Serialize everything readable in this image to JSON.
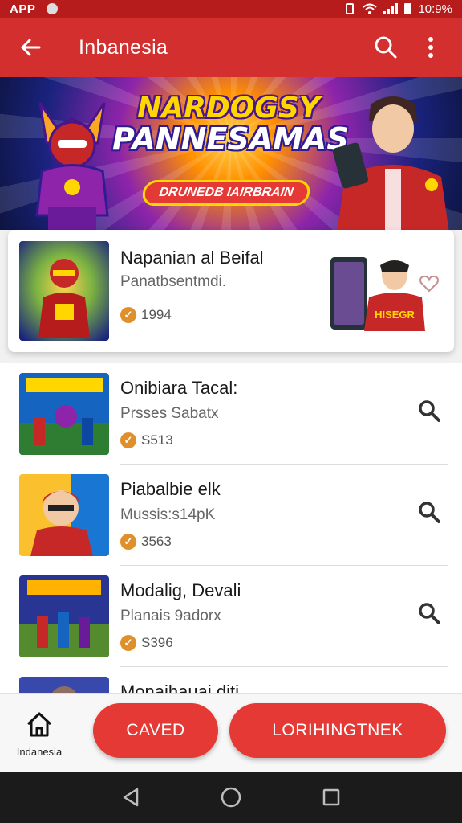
{
  "status_bar": {
    "app_label": "APP",
    "time": "10:9%"
  },
  "app_bar": {
    "title": "Inbanesia"
  },
  "banner": {
    "title_line1": "NARDOGSY",
    "title_line2": "PANNESAMAS",
    "tag": "DRUNEDB IAIRBRAIN"
  },
  "featured": {
    "title": "Napanian al Beifal",
    "subtitle": "Panatbsentmdi.",
    "meta": "1994",
    "promo_shirt": "HISEGR"
  },
  "list": [
    {
      "title": "Onibiara Tacal:",
      "subtitle": "Prsses Sabatx",
      "meta": "S513"
    },
    {
      "title": "Piabalbie elk",
      "subtitle": "Mussis:s14pK",
      "meta": "3563"
    },
    {
      "title": "Modalig, Devali",
      "subtitle": "Planais 9adorx",
      "meta": "S396"
    },
    {
      "title": "Monaihauai diti",
      "subtitle": "",
      "meta": ""
    }
  ],
  "bottom": {
    "home_label": "Indanesia",
    "saved_label": "CAVED",
    "primary_label": "LORIHINGTNEK"
  },
  "colors": {
    "primary": "#d32f2f",
    "accent": "#e53935",
    "badge": "#e0902b"
  },
  "icons": [
    "back-arrow-icon",
    "search-icon",
    "more-vert-icon",
    "heart-icon",
    "home-icon",
    "nav-back-icon",
    "nav-home-icon",
    "nav-recents-icon"
  ]
}
